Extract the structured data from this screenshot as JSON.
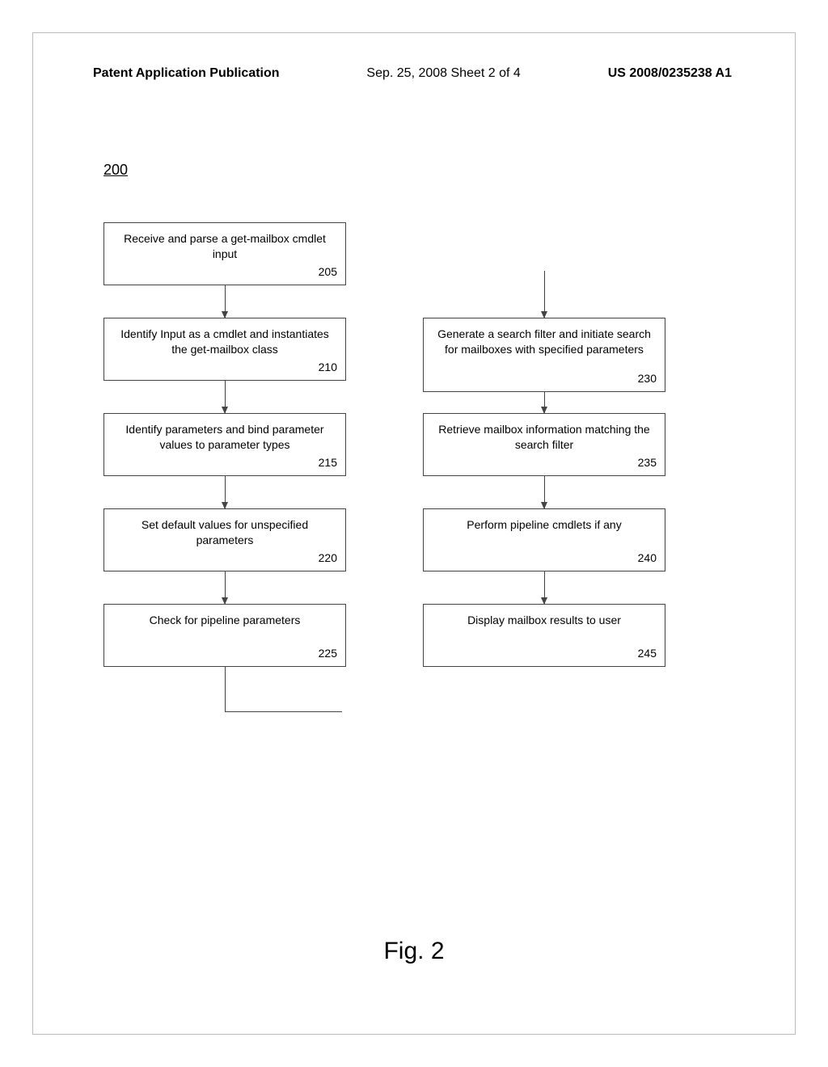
{
  "header": {
    "left": "Patent Application Publication",
    "mid": "Sep. 25, 2008  Sheet 2 of 4",
    "right": "US 2008/0235238 A1"
  },
  "figure_ref": "200",
  "boxes": {
    "b205": {
      "text": "Receive and parse a get-mailbox cmdlet input",
      "num": "205"
    },
    "b210": {
      "text": "Identify Input as a cmdlet and instantiates the get-mailbox class",
      "num": "210"
    },
    "b215": {
      "text": "Identify parameters and bind parameter values to parameter types",
      "num": "215"
    },
    "b220": {
      "text": "Set default values for unspecified parameters",
      "num": "220"
    },
    "b225": {
      "text": "Check for pipeline parameters",
      "num": "225"
    },
    "b230": {
      "text": "Generate a search filter and initiate search for mailboxes with specified parameters",
      "num": "230"
    },
    "b235": {
      "text": "Retrieve mailbox information matching the search filter",
      "num": "235"
    },
    "b240": {
      "text": "Perform pipeline cmdlets if any",
      "num": "240"
    },
    "b245": {
      "text": "Display mailbox results to user",
      "num": "245"
    }
  },
  "caption": "Fig. 2"
}
